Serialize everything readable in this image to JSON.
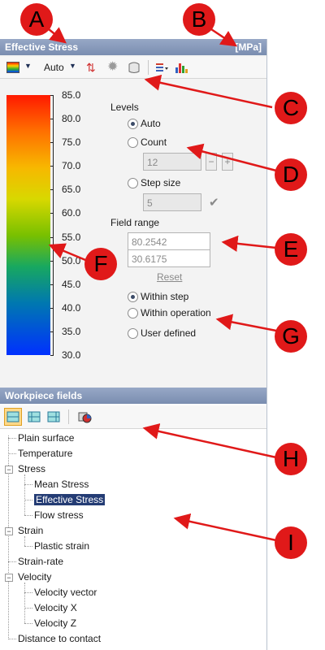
{
  "callouts": [
    "A",
    "B",
    "C",
    "D",
    "E",
    "F",
    "G",
    "H",
    "I"
  ],
  "top_panel": {
    "title": "Effective Stress",
    "unit": "[MPa]",
    "toolbar": {
      "palette_icon": "color-palette-icon",
      "mode_label": "Auto",
      "icons": [
        "swap-arrows-icon",
        "gear-icon",
        "shape-icon",
        "list-settings-icon",
        "bar-chart-icon"
      ]
    },
    "scale_ticks": [
      "85.0",
      "80.0",
      "75.0",
      "70.0",
      "65.0",
      "60.0",
      "55.0",
      "50.0",
      "45.0",
      "40.0",
      "35.0",
      "30.0"
    ],
    "levels": {
      "heading": "Levels",
      "auto": "Auto",
      "count": "Count",
      "count_value": "12",
      "step_size": "Step size",
      "step_value": "5",
      "selected": "auto"
    },
    "field_range": {
      "heading": "Field range",
      "max": "80.2542",
      "min": "30.6175",
      "reset": "Reset",
      "within_step": "Within step",
      "within_operation": "Within operation",
      "user_defined": "User defined",
      "selected": "within_step"
    }
  },
  "bottom_panel": {
    "title": "Workpiece fields",
    "toolbar_icons": [
      "view-mode-1-icon",
      "view-mode-2-icon",
      "view-mode-3-icon",
      "workpiece-color-icon"
    ],
    "tree": [
      {
        "label": "Plain surface"
      },
      {
        "label": "Temperature"
      },
      {
        "label": "Stress"
      },
      {
        "label": "Mean Stress"
      },
      {
        "label": "Effective Stress",
        "selected": true
      },
      {
        "label": "Flow stress"
      },
      {
        "label": "Strain"
      },
      {
        "label": "Plastic strain"
      },
      {
        "label": "Strain-rate"
      },
      {
        "label": "Velocity"
      },
      {
        "label": "Velocity vector"
      },
      {
        "label": "Velocity X"
      },
      {
        "label": "Velocity Z"
      },
      {
        "label": "Distance to contact"
      }
    ]
  }
}
